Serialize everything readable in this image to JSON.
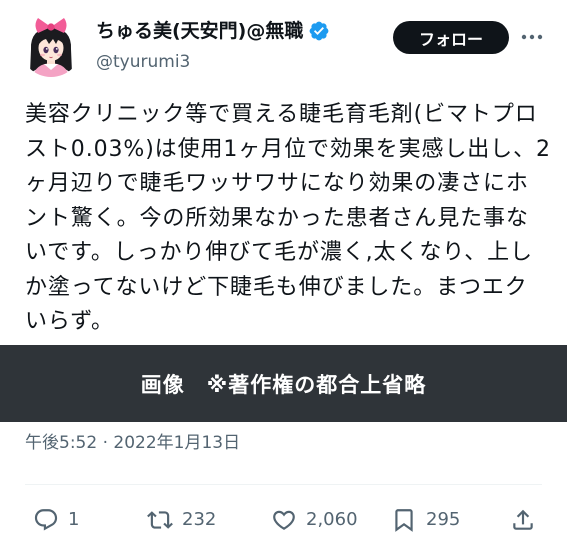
{
  "author": {
    "display_name": "ちゅる美(天安門)@無職",
    "handle": "@tyurumi3",
    "verified": true,
    "avatar_icon": "anime-girl-avatar",
    "verified_icon": "verified-badge-icon"
  },
  "header": {
    "follow_label": "フォロー",
    "more_icon": "more-horizontal-icon"
  },
  "tweet": {
    "text_lines": [
      "美容クリニック等で買える睫毛育毛剤(ビマトプロ",
      "スト0.03%)は使用1ヶ月位で効果を実感し出し、2",
      "ヶ月辺りで睫毛ワッサワサになり効果の凄さにホ",
      "ント驚く。今の所効果なかった患者さん見た事な",
      "いです。しっかり伸びて毛が濃く,太くなり、上し",
      "か塗ってないけど下睫毛も伸びました。まつエク",
      "いらず。"
    ],
    "media_placeholder_label": "画像　※著作権の都合上省略",
    "timestamp": "午後5:52 · 2022年1月13日"
  },
  "actions": {
    "reply": {
      "icon": "reply-icon",
      "count": "1"
    },
    "retweet": {
      "icon": "retweet-icon",
      "count": "232"
    },
    "like": {
      "icon": "heart-icon",
      "count": "2,060"
    },
    "bookmark": {
      "icon": "bookmark-icon",
      "count": "295"
    },
    "share": {
      "icon": "share-icon"
    }
  },
  "colors": {
    "text_primary": "#0f1419",
    "text_secondary": "#536471",
    "verified_blue": "#1d9bf0",
    "follow_button_bg": "#0f1419",
    "follow_button_text": "#ffffff",
    "media_placeholder_bg": "#2f3439",
    "media_placeholder_text": "#ffffff",
    "divider": "#eff3f4",
    "background": "#ffffff"
  }
}
